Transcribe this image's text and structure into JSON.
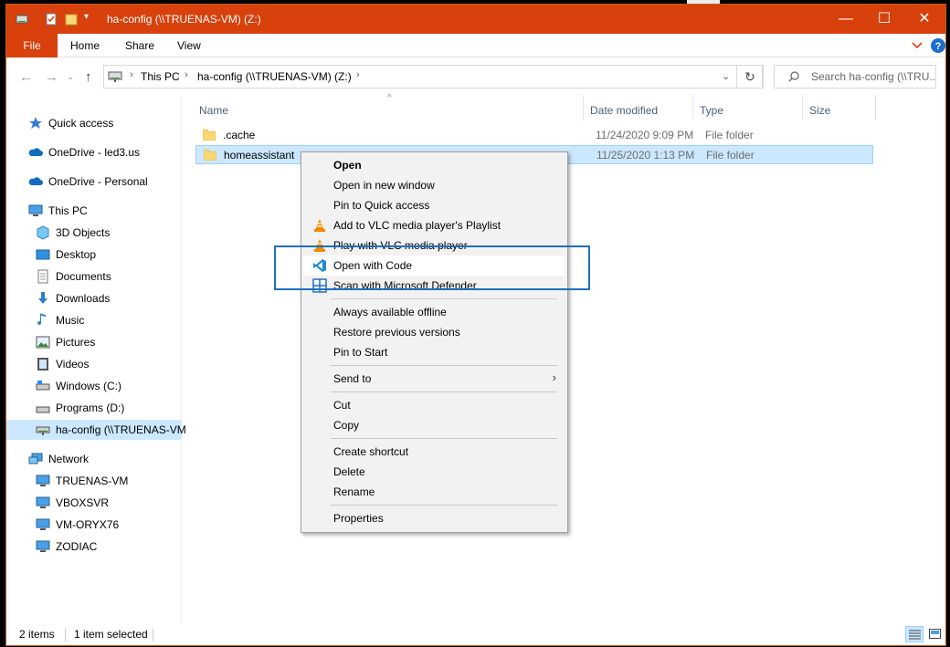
{
  "window": {
    "title": "ha-config (\\\\TRUENAS-VM) (Z:)",
    "accent_color": "#d8400c",
    "controls": [
      "minimize-icon",
      "maximize-icon",
      "close-icon"
    ]
  },
  "ribbon": {
    "tabs": [
      "File",
      "Home",
      "Share",
      "View"
    ],
    "help_icon": "help-icon",
    "expand_icon": "chevron-down-icon"
  },
  "address": {
    "crumbs": [
      "This PC",
      "ha-config (\\\\TRUENAS-VM) (Z:)"
    ],
    "search_placeholder": "Search ha-config (\\\\TRU..."
  },
  "nav": {
    "items": [
      {
        "label": "Quick access",
        "icon": "star-icon"
      },
      {
        "label": "OneDrive - led3.us",
        "icon": "cloud-icon"
      },
      {
        "label": "OneDrive - Personal",
        "icon": "cloud-icon"
      },
      {
        "label": "This PC",
        "icon": "computer-icon"
      },
      {
        "label": "3D Objects",
        "icon": "cube-icon"
      },
      {
        "label": "Desktop",
        "icon": "desktop-icon"
      },
      {
        "label": "Documents",
        "icon": "document-icon"
      },
      {
        "label": "Downloads",
        "icon": "download-icon"
      },
      {
        "label": "Music",
        "icon": "music-icon"
      },
      {
        "label": "Pictures",
        "icon": "picture-icon"
      },
      {
        "label": "Videos",
        "icon": "video-icon"
      },
      {
        "label": "Windows (C:)",
        "icon": "drive-icon"
      },
      {
        "label": "Programs (D:)",
        "icon": "drive-icon"
      },
      {
        "label": "ha-config (\\\\TRUENAS-VM",
        "icon": "network-drive-icon"
      },
      {
        "label": "Network",
        "icon": "network-icon"
      },
      {
        "label": "TRUENAS-VM",
        "icon": "monitor-icon"
      },
      {
        "label": "VBOXSVR",
        "icon": "monitor-icon"
      },
      {
        "label": "VM-ORYX76",
        "icon": "monitor-icon"
      },
      {
        "label": "ZODIAC",
        "icon": "monitor-icon"
      }
    ]
  },
  "columns": {
    "name": "Name",
    "date": "Date modified",
    "type": "Type",
    "size": "Size"
  },
  "files": [
    {
      "name": ".cache",
      "date": "11/24/2020 9:09 PM",
      "type": "File folder"
    },
    {
      "name": "homeassistant",
      "date": "11/25/2020 1:13 PM",
      "type": "File folder"
    }
  ],
  "context_menu": {
    "items": [
      {
        "label": "Open"
      },
      {
        "label": "Open in new window"
      },
      {
        "label": "Pin to Quick access"
      },
      {
        "label": "Add to VLC media player's Playlist",
        "icon": "vlc-icon"
      },
      {
        "label": "Play with VLC media player",
        "icon": "vlc-icon"
      },
      {
        "label": "Open with Code",
        "icon": "vscode-icon"
      },
      {
        "label": "Scan with Microsoft Defender",
        "icon": "defender-icon"
      },
      {
        "label": "Always available offline"
      },
      {
        "label": "Restore previous versions"
      },
      {
        "label": "Pin to Start"
      },
      {
        "label": "Send to"
      },
      {
        "label": "Cut"
      },
      {
        "label": "Copy"
      },
      {
        "label": "Create shortcut"
      },
      {
        "label": "Delete"
      },
      {
        "label": "Rename"
      },
      {
        "label": "Properties"
      }
    ]
  },
  "status": {
    "items": "2 items",
    "selected": "1 item selected"
  }
}
